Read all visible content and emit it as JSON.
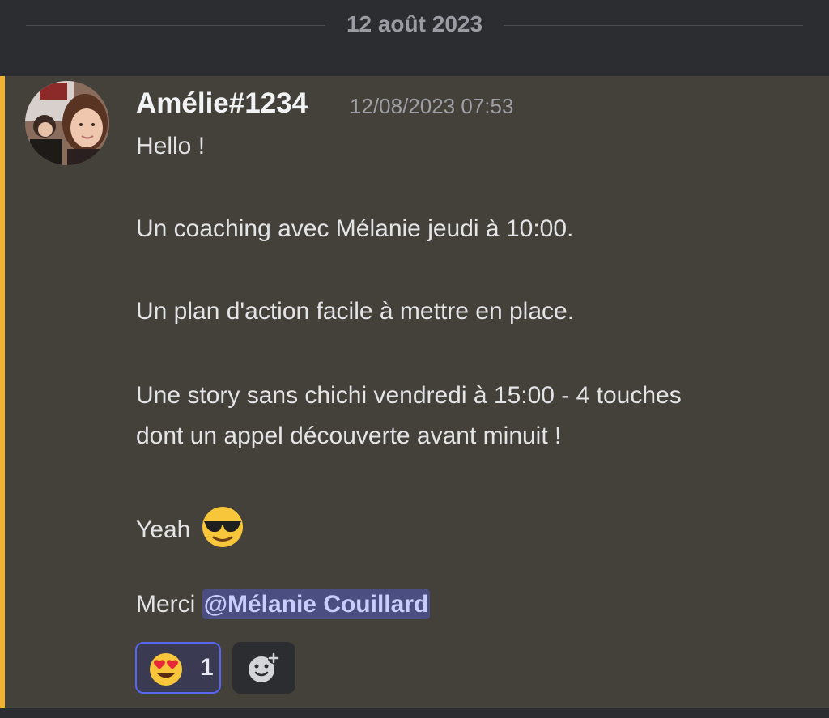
{
  "date_divider": {
    "label": "12 août 2023"
  },
  "message": {
    "author": "Amélie#1234",
    "timestamp": "12/08/2023 07:53",
    "lines": [
      "Hello !",
      "Un coaching avec Mélanie jeudi à 10:00.",
      "Un plan d'action facile à mettre en place.",
      "Une story sans chichi vendredi à 15:00 - 4 touches",
      "dont un appel découverte avant minuit !",
      "Yeah",
      "Merci"
    ],
    "inline_emoji": "smiling-face-with-sunglasses-icon",
    "mention": "@Mélanie Couillard",
    "highlight_color": "#f0b232"
  },
  "reactions": [
    {
      "emoji": "heart-eyes-icon",
      "count": "1",
      "selected": true
    }
  ],
  "add_reaction": {
    "icon": "add-reaction-icon"
  }
}
